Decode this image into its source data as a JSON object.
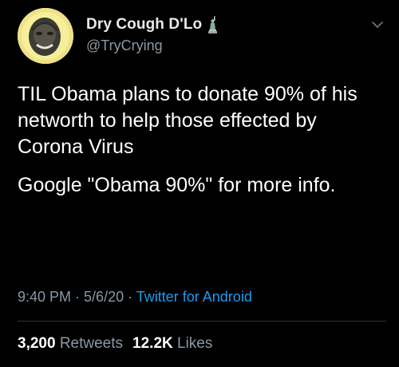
{
  "author": {
    "display_name": "Dry Cough D'Lo",
    "handle": "@TryCrying",
    "badge_icon": "statue-of-liberty-icon",
    "avatar_bg": "#efe08a"
  },
  "tweet": {
    "text_line1": "TIL Obama plans to donate 90% of his networth to help those effected by Corona Virus",
    "text_line2": "Google \"Obama 90%\" for more info."
  },
  "meta": {
    "time": "9:40 PM",
    "sep1": " · ",
    "date": "5/6/20",
    "sep2": " · ",
    "source": "Twitter for Android"
  },
  "stats": {
    "retweets_count": "3,200",
    "retweets_label": "Retweets",
    "likes_count": "12.2K",
    "likes_label": "Likes"
  },
  "colors": {
    "background": "#000000",
    "text": "#ffffff",
    "muted": "#8b98a5",
    "link": "#1d9bf0"
  },
  "icons": {
    "menu": "chevron-down-icon"
  }
}
